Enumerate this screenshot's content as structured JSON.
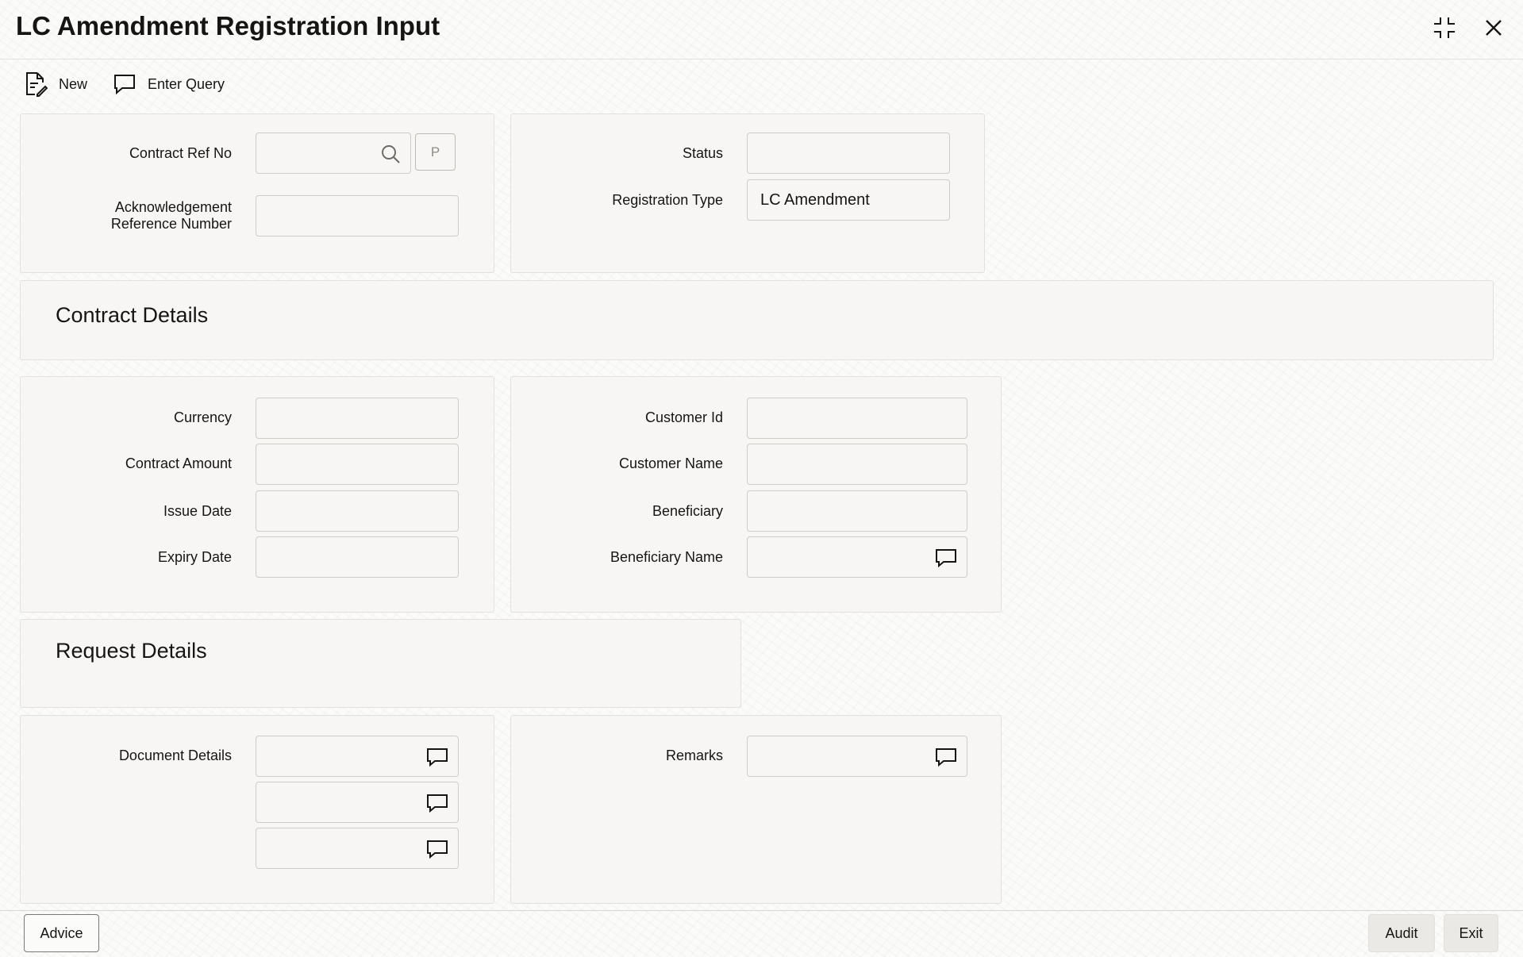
{
  "header": {
    "title": "LC Amendment Registration Input"
  },
  "toolbar": {
    "new_label": "New",
    "enter_query_label": "Enter Query"
  },
  "top_left": {
    "contract_ref_label": "Contract Ref No",
    "contract_ref_value": "",
    "p_button_label": "P",
    "ack_ref_label_line1": "Acknowledgement",
    "ack_ref_label_line2": "Reference Number",
    "ack_ref_value": ""
  },
  "top_right": {
    "status_label": "Status",
    "status_value": "",
    "registration_type_label": "Registration Type",
    "registration_type_value": "LC Amendment"
  },
  "contract_details": {
    "title": "Contract Details",
    "currency_label": "Currency",
    "currency_value": "",
    "contract_amount_label": "Contract Amount",
    "contract_amount_value": "",
    "issue_date_label": "Issue Date",
    "issue_date_value": "",
    "expiry_date_label": "Expiry Date",
    "expiry_date_value": "",
    "customer_id_label": "Customer Id",
    "customer_id_value": "",
    "customer_name_label": "Customer Name",
    "customer_name_value": "",
    "beneficiary_label": "Beneficiary",
    "beneficiary_value": "",
    "beneficiary_name_label": "Beneficiary Name",
    "beneficiary_name_value": ""
  },
  "request_details": {
    "title": "Request Details",
    "document_details_label": "Document Details",
    "document_details_values": [
      "",
      "",
      ""
    ],
    "remarks_label": "Remarks",
    "remarks_value": ""
  },
  "footer": {
    "advice_label": "Advice",
    "audit_label": "Audit",
    "exit_label": "Exit"
  },
  "icons": {
    "new": "document-edit-icon",
    "enter_query": "speech-bubble-icon",
    "search": "search-icon",
    "text_editor": "speech-bubble-icon",
    "minimize": "collapse-icon",
    "close": "close-icon"
  }
}
